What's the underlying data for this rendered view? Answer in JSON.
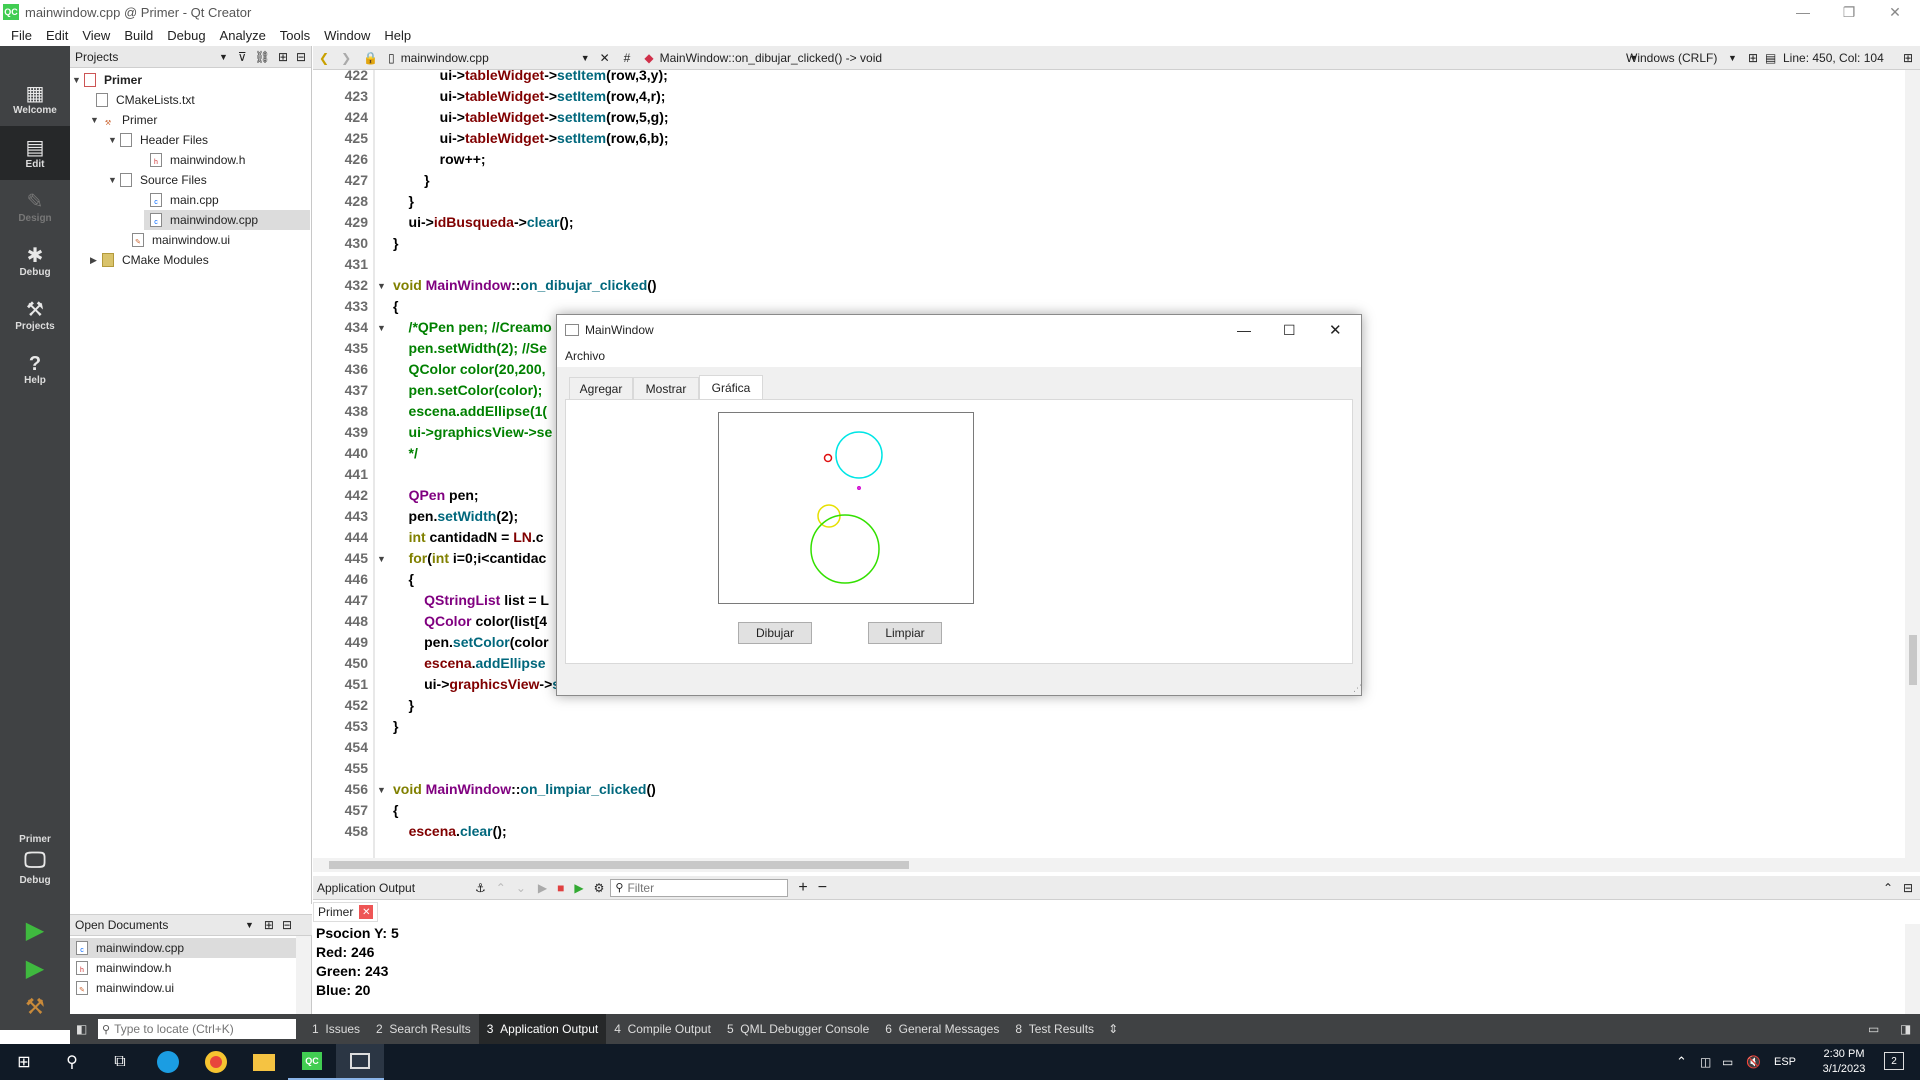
{
  "window": {
    "title": "mainwindow.cpp @ Primer - Qt Creator",
    "logo": "QC"
  },
  "menu": [
    "File",
    "Edit",
    "View",
    "Build",
    "Debug",
    "Analyze",
    "Tools",
    "Window",
    "Help"
  ],
  "modes": [
    {
      "label": "Welcome",
      "icon": "grid-icon",
      "glyph": "▦"
    },
    {
      "label": "Edit",
      "icon": "edit-icon",
      "glyph": "▤"
    },
    {
      "label": "Design",
      "icon": "pencil-icon",
      "glyph": "✎"
    },
    {
      "label": "Debug",
      "icon": "bug-icon",
      "glyph": "✱"
    },
    {
      "label": "Projects",
      "icon": "wrench-icon",
      "glyph": "⚒"
    },
    {
      "label": "Help",
      "icon": "help-icon",
      "glyph": "?"
    }
  ],
  "kit": {
    "name": "Primer",
    "mode": "Debug"
  },
  "projects": {
    "header": "Projects",
    "tree": [
      {
        "label": "Primer",
        "bold": true
      },
      {
        "label": "CMakeLists.txt"
      },
      {
        "label": "Primer"
      },
      {
        "label": "Header Files"
      },
      {
        "label": "mainwindow.h"
      },
      {
        "label": "Source Files"
      },
      {
        "label": "main.cpp"
      },
      {
        "label": "mainwindow.cpp",
        "selected": true
      },
      {
        "label": "mainwindow.ui"
      },
      {
        "label": "CMake Modules"
      }
    ]
  },
  "open_documents": {
    "header": "Open Documents",
    "items": [
      "mainwindow.cpp",
      "mainwindow.h",
      "mainwindow.ui"
    ]
  },
  "editor": {
    "file": "mainwindow.cpp",
    "symbol_hash": "#",
    "function": "MainWindow::on_dibujar_clicked() -> void",
    "line_endings": "Windows (CRLF)",
    "position": "Line: 450, Col: 104"
  },
  "code_lines": [
    {
      "n": "422",
      "t": "            ui->tableWidget->setItem(row,3,y);"
    },
    {
      "n": "423",
      "t": "            ui->tableWidget->setItem(row,4,r);"
    },
    {
      "n": "424",
      "t": "            ui->tableWidget->setItem(row,5,g);"
    },
    {
      "n": "425",
      "t": "            ui->tableWidget->setItem(row,6,b);"
    },
    {
      "n": "426",
      "t": "            row++;"
    },
    {
      "n": "427",
      "t": "        }"
    },
    {
      "n": "428",
      "t": "    }"
    },
    {
      "n": "429",
      "t": "    ui->idBusqueda->clear();"
    },
    {
      "n": "430",
      "t": "}"
    },
    {
      "n": "431",
      "t": ""
    },
    {
      "n": "432",
      "t": "void MainWindow::on_dibujar_clicked()"
    },
    {
      "n": "433",
      "t": "{"
    },
    {
      "n": "434",
      "t": "    /*QPen pen; //Creamo"
    },
    {
      "n": "435",
      "t": "    pen.setWidth(2); //Se"
    },
    {
      "n": "436",
      "t": "    QColor color(20,200,"
    },
    {
      "n": "437",
      "t": "    pen.setColor(color);"
    },
    {
      "n": "438",
      "t": "    escena.addEllipse(1("
    },
    {
      "n": "439",
      "t": "    ui->graphicsView->se"
    },
    {
      "n": "440",
      "t": "    */"
    },
    {
      "n": "441",
      "t": ""
    },
    {
      "n": "442",
      "t": "    QPen pen;"
    },
    {
      "n": "443",
      "t": "    pen.setWidth(2);"
    },
    {
      "n": "444",
      "t": "    int cantidadN = LN.c"
    },
    {
      "n": "445",
      "t": "    for(int i=0;i<cantidac"
    },
    {
      "n": "446",
      "t": "    {"
    },
    {
      "n": "447",
      "t": "        QStringList list = L"
    },
    {
      "n": "448",
      "t": "        QColor color(list[4"
    },
    {
      "n": "449",
      "t": "        pen.setColor(color"
    },
    {
      "n": "450",
      "t": "        escena.addEllipse"
    },
    {
      "n": "451",
      "t": "        ui->graphicsView->setScene(&escena);"
    },
    {
      "n": "452",
      "t": "    }"
    },
    {
      "n": "453",
      "t": "}"
    },
    {
      "n": "454",
      "t": ""
    },
    {
      "n": "455",
      "t": ""
    },
    {
      "n": "456",
      "t": "void MainWindow::on_limpiar_clicked()"
    },
    {
      "n": "457",
      "t": "{"
    },
    {
      "n": "458",
      "t": "    escena.clear();"
    }
  ],
  "output": {
    "header": "Application Output",
    "filter_placeholder": "Filter",
    "tab": "Primer",
    "lines": [
      "Psocion Y: 5",
      "Red: 246",
      "Green: 243",
      "Blue: 20"
    ]
  },
  "statusbar": {
    "locate_placeholder": "Type to locate (Ctrl+K)",
    "tabs": [
      {
        "n": "1",
        "label": "Issues"
      },
      {
        "n": "2",
        "label": "Search Results"
      },
      {
        "n": "3",
        "label": "Application Output",
        "active": true
      },
      {
        "n": "4",
        "label": "Compile Output"
      },
      {
        "n": "5",
        "label": "QML Debugger Console"
      },
      {
        "n": "6",
        "label": "General Messages"
      },
      {
        "n": "8",
        "label": "Test Results"
      }
    ]
  },
  "app_window": {
    "title": "MainWindow",
    "menu": "Archivo",
    "tabs": [
      "Agregar",
      "Mostrar",
      "Gráfica"
    ],
    "active_tab": "Gráfica",
    "buttons": {
      "draw": "Dibujar",
      "clear": "Limpiar"
    },
    "colors": {
      "cyan": "#00e5e5",
      "red": "#e01010",
      "magenta": "#d000d0",
      "yellow": "#e6e000",
      "green": "#33e000"
    }
  },
  "taskbar": {
    "lang": "ESP",
    "time": "2:30 PM",
    "date": "3/1/2023",
    "notifications": "2"
  }
}
